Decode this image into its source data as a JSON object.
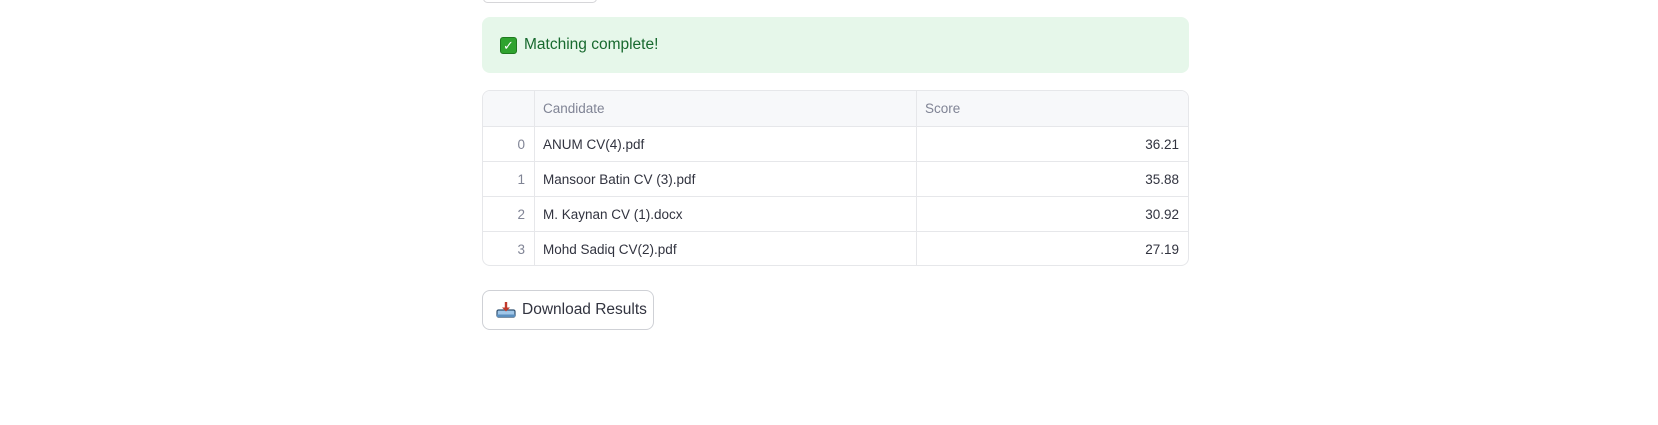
{
  "alert": {
    "icon": "check-mark-icon",
    "message": "Matching complete!",
    "color": "#17692e",
    "background": "#e6f7ea"
  },
  "results_table": {
    "columns": [
      "",
      "Candidate",
      "Score"
    ],
    "rows": [
      {
        "index": "0",
        "candidate": "ANUM CV(4).pdf",
        "score": "36.21"
      },
      {
        "index": "1",
        "candidate": "Mansoor Batin CV (3).pdf",
        "score": "35.88"
      },
      {
        "index": "2",
        "candidate": "M. Kaynan CV (1).docx",
        "score": "30.92"
      },
      {
        "index": "3",
        "candidate": "Mohd Sadiq CV(2).pdf",
        "score": "27.19"
      }
    ]
  },
  "download": {
    "label": "Download Results",
    "icon": "inbox-tray-icon"
  }
}
